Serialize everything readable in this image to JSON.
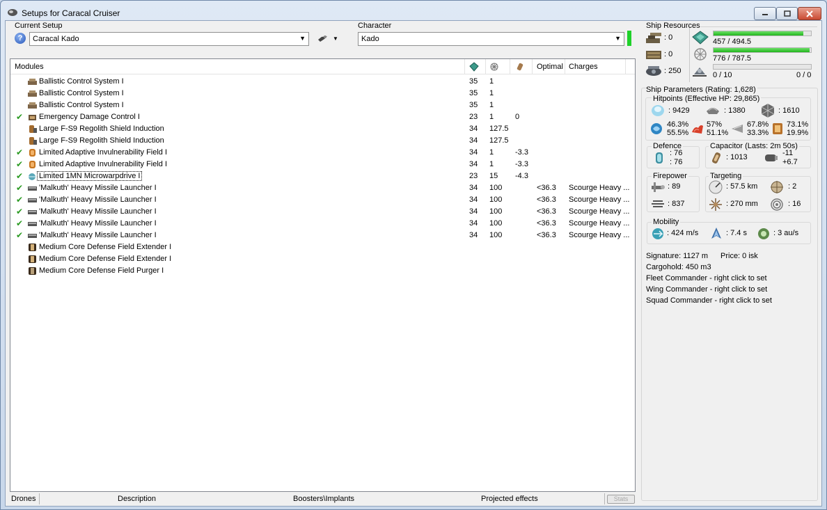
{
  "window": {
    "title": "Setups for Caracal Cruiser"
  },
  "setup": {
    "label": "Current Setup",
    "value": "Caracal Kado"
  },
  "character": {
    "label": "Character",
    "value": "Kado"
  },
  "modules": {
    "headers": {
      "name": "Modules",
      "optimal": "Optimal",
      "charges": "Charges"
    },
    "rows": [
      {
        "checked": false,
        "name": "Ballistic Control System I",
        "cpu": "35",
        "pg": "1",
        "cap": "",
        "optimal": "",
        "charges": "",
        "icon": "ballistic-control-icon"
      },
      {
        "checked": false,
        "name": "Ballistic Control System I",
        "cpu": "35",
        "pg": "1",
        "cap": "",
        "optimal": "",
        "charges": "",
        "icon": "ballistic-control-icon"
      },
      {
        "checked": false,
        "name": "Ballistic Control System I",
        "cpu": "35",
        "pg": "1",
        "cap": "",
        "optimal": "",
        "charges": "",
        "icon": "ballistic-control-icon"
      },
      {
        "checked": true,
        "name": "Emergency Damage Control I",
        "cpu": "23",
        "pg": "1",
        "cap": "0",
        "optimal": "",
        "charges": "",
        "icon": "damage-control-icon"
      },
      {
        "checked": false,
        "name": "Large F-S9 Regolith Shield Induction",
        "cpu": "34",
        "pg": "127.5",
        "cap": "",
        "optimal": "",
        "charges": "",
        "icon": "shield-induction-icon"
      },
      {
        "checked": false,
        "name": "Large F-S9 Regolith Shield Induction",
        "cpu": "34",
        "pg": "127.5",
        "cap": "",
        "optimal": "",
        "charges": "",
        "icon": "shield-induction-icon"
      },
      {
        "checked": true,
        "name": "Limited Adaptive Invulnerability Field I",
        "cpu": "34",
        "pg": "1",
        "cap": "-3.3",
        "optimal": "",
        "charges": "",
        "icon": "invulnerability-field-icon"
      },
      {
        "checked": true,
        "name": "Limited Adaptive Invulnerability Field I",
        "cpu": "34",
        "pg": "1",
        "cap": "-3.3",
        "optimal": "",
        "charges": "",
        "icon": "invulnerability-field-icon"
      },
      {
        "checked": true,
        "name": "Limited 1MN Microwarpdrive I",
        "cpu": "23",
        "pg": "15",
        "cap": "-4.3",
        "optimal": "",
        "charges": "",
        "icon": "microwarpdrive-icon"
      },
      {
        "checked": true,
        "name": "'Malkuth' Heavy Missile Launcher I",
        "cpu": "34",
        "pg": "100",
        "cap": "",
        "optimal": "<36.3",
        "charges": "Scourge Heavy ...",
        "icon": "missile-launcher-icon"
      },
      {
        "checked": true,
        "name": "'Malkuth' Heavy Missile Launcher I",
        "cpu": "34",
        "pg": "100",
        "cap": "",
        "optimal": "<36.3",
        "charges": "Scourge Heavy ...",
        "icon": "missile-launcher-icon"
      },
      {
        "checked": true,
        "name": "'Malkuth' Heavy Missile Launcher I",
        "cpu": "34",
        "pg": "100",
        "cap": "",
        "optimal": "<36.3",
        "charges": "Scourge Heavy ...",
        "icon": "missile-launcher-icon"
      },
      {
        "checked": true,
        "name": "'Malkuth' Heavy Missile Launcher I",
        "cpu": "34",
        "pg": "100",
        "cap": "",
        "optimal": "<36.3",
        "charges": "Scourge Heavy ...",
        "icon": "missile-launcher-icon"
      },
      {
        "checked": true,
        "name": "'Malkuth' Heavy Missile Launcher I",
        "cpu": "34",
        "pg": "100",
        "cap": "",
        "optimal": "<36.3",
        "charges": "Scourge Heavy ...",
        "icon": "missile-launcher-icon"
      },
      {
        "checked": false,
        "name": "Medium Core Defense Field Extender I",
        "cpu": "",
        "pg": "",
        "cap": "",
        "optimal": "",
        "charges": "",
        "icon": "field-extender-icon"
      },
      {
        "checked": false,
        "name": "Medium Core Defense Field Extender I",
        "cpu": "",
        "pg": "",
        "cap": "",
        "optimal": "",
        "charges": "",
        "icon": "field-extender-icon"
      },
      {
        "checked": false,
        "name": "Medium Core Defense Field Purger I",
        "cpu": "",
        "pg": "",
        "cap": "",
        "optimal": "",
        "charges": "",
        "icon": "field-purger-icon"
      }
    ]
  },
  "bottom_tabs": {
    "drones": "Drones",
    "description": "Description",
    "boosters": "Boosters\\Implants",
    "projected": "Projected effects",
    "stats": "Stats"
  },
  "resources": {
    "title": "Ship Resources",
    "turrets": ": 0",
    "launchers": ": 0",
    "drone_bay": ": 250",
    "cpu": {
      "text": "457 / 494.5",
      "fraction": 0.924
    },
    "powergrid": {
      "text": "776 / 787.5",
      "fraction": 0.985
    },
    "drones": {
      "left": "0 / 10",
      "right": "0 / 0",
      "fraction": 0
    }
  },
  "params": {
    "title": "Ship Parameters (Rating: 1,628)",
    "hitpoints_title": "Hitpoints (Effective HP: 29,865)",
    "shield_hp": ": 9429",
    "armor_hp": ": 1380",
    "structure_hp": ": 1610",
    "resists": [
      {
        "top": "46.3%",
        "bottom": "55.5%"
      },
      {
        "top": "57%",
        "bottom": "51.1%"
      },
      {
        "top": "67.8%",
        "bottom": "33.3%"
      },
      {
        "top": "73.1%",
        "bottom": "19.9%"
      }
    ],
    "defence": {
      "title": "Defence",
      "top": ": 76",
      "bottom": ": 76"
    },
    "capacitor": {
      "title": "Capacitor (Lasts: 2m 50s)",
      "amount": ": 1013",
      "top": "-11",
      "bottom": "+6.7"
    },
    "firepower": {
      "title": "Firepower",
      "dps": ": 89",
      "volley": ": 837"
    },
    "targeting": {
      "title": "Targeting",
      "range": ": 57.5 km",
      "targets": ": 2",
      "resolution": ": 270 mm",
      "sensor": ": 16"
    },
    "mobility": {
      "title": "Mobility",
      "speed": ": 424 m/s",
      "align": ": 7.4 s",
      "warp": ": 3 au/s"
    },
    "signature": "Signature: 1127 m",
    "price": "Price: 0 isk",
    "cargohold": "Cargohold: 450 m3",
    "fleet_commander": "Fleet Commander - right click to set",
    "wing_commander": "Wing Commander - right click to set",
    "squad_commander": "Squad Commander - right click to set"
  },
  "colors": {
    "accent_green": "#1fd12a",
    "check_green": "#2a9a21",
    "title_gradient": "#c8d7ea"
  }
}
